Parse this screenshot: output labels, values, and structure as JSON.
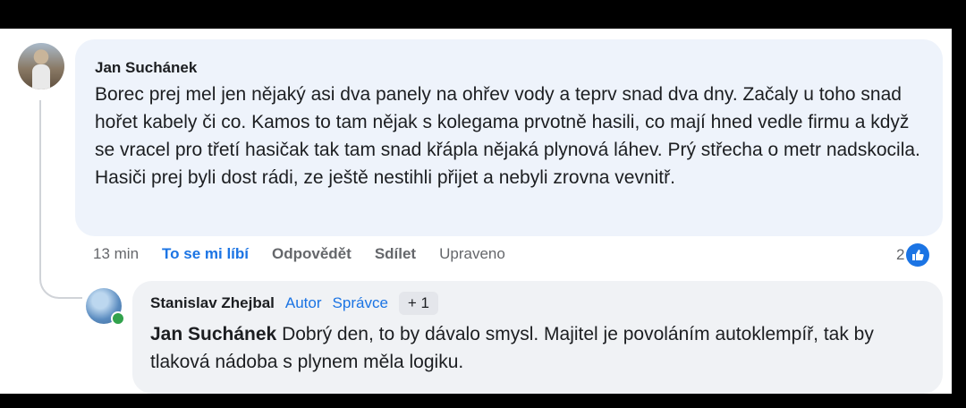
{
  "comment": {
    "author": "Jan Suchánek",
    "text": "Borec prej mel jen nějaký asi dva panely na ohřev vody a teprv snad dva dny. Začaly u toho snad hořet kabely či co. Kamos to tam nějak s kolegama prvotně hasili, co mají hned vedle firmu a když se vracel pro třetí hasičak tak tam snad křápla nějaká plynová láhev. Prý střecha o metr nadskocila. Hasiči prej byli dost rádi, ze ještě nestihli přijet a nebyli zrovna vevnitř.",
    "actions": {
      "time": "13 min",
      "like": "To se mi líbí",
      "reply": "Odpovědět",
      "share": "Sdílet",
      "edited": "Upraveno"
    },
    "reaction_count": "2"
  },
  "reply": {
    "author": "Stanislav Zhejbal",
    "badge_author": "Autor",
    "badge_admin": "Správce",
    "badge_plus": "+ 1",
    "mention": "Jan Suchánek",
    "text": " Dobrý den, to by dávalo smysl. Majitel je povoláním autoklempíř, tak by tlaková nádoba s plynem měla logiku."
  },
  "colors": {
    "accent": "#1b74e4",
    "bubble_main": "#eef3fb",
    "bubble_reply": "#f0f2f5",
    "online": "#31a24c"
  },
  "icons": [
    "like-icon",
    "online-status-icon"
  ]
}
